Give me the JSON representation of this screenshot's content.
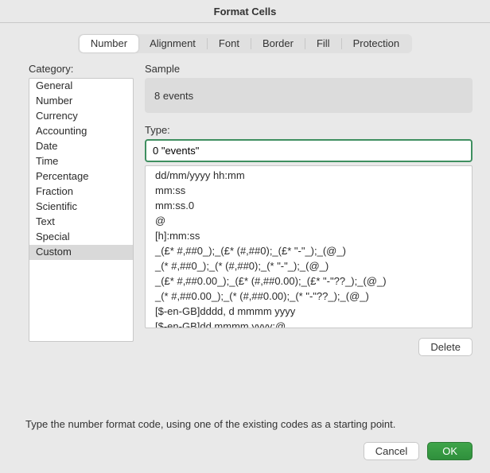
{
  "title": "Format Cells",
  "tabs": {
    "number": "Number",
    "alignment": "Alignment",
    "font": "Font",
    "border": "Border",
    "fill": "Fill",
    "protection": "Protection"
  },
  "labels": {
    "category": "Category:",
    "sample": "Sample",
    "type": "Type:"
  },
  "categories": [
    "General",
    "Number",
    "Currency",
    "Accounting",
    "Date",
    "Time",
    "Percentage",
    "Fraction",
    "Scientific",
    "Text",
    "Special",
    "Custom"
  ],
  "selected_category_index": 11,
  "sample_value": "8 events",
  "type_value": "0 \"events\"",
  "format_codes": [
    "dd/mm/yyyy hh:mm",
    "mm:ss",
    "mm:ss.0",
    "@",
    "[h]:mm:ss",
    "_(£* #,##0_);_(£* (#,##0);_(£* \"-\"_);_(@_)",
    "_(* #,##0_);_(* (#,##0);_(* \"-\"_);_(@_)",
    "_(£* #,##0.00_);_(£* (#,##0.00);_(£* \"-\"??_);_(@_)",
    "_(* #,##0.00_);_(* (#,##0.00);_(* \"-\"??_);_(@_)",
    "[$-en-GB]dddd, d mmmm yyyy",
    "[$-en-GB]dd mmmm yyyy;@"
  ],
  "buttons": {
    "delete": "Delete",
    "cancel": "Cancel",
    "ok": "OK"
  },
  "hint": "Type the number format code, using one of the existing codes as a starting point."
}
